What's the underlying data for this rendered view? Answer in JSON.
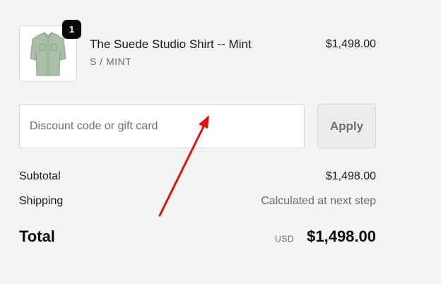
{
  "product": {
    "name": "The Suede Studio Shirt -- Mint",
    "variant": "S / MINT",
    "price": "$1,498.00",
    "quantity": "1",
    "image_icon": "mint-shirt-thumbnail"
  },
  "discount": {
    "placeholder": "Discount code or gift card",
    "value": "",
    "apply_label": "Apply"
  },
  "summary": {
    "subtotal_label": "Subtotal",
    "subtotal_value": "$1,498.00",
    "shipping_label": "Shipping",
    "shipping_value": "Calculated at next step",
    "total_label": "Total",
    "total_currency": "USD",
    "total_value": "$1,498.00"
  },
  "colors": {
    "background": "#f4f4f4",
    "shirt": "#a9bfa8",
    "badge": "#0a0a0a",
    "annotation_arrow": "#e01010"
  }
}
